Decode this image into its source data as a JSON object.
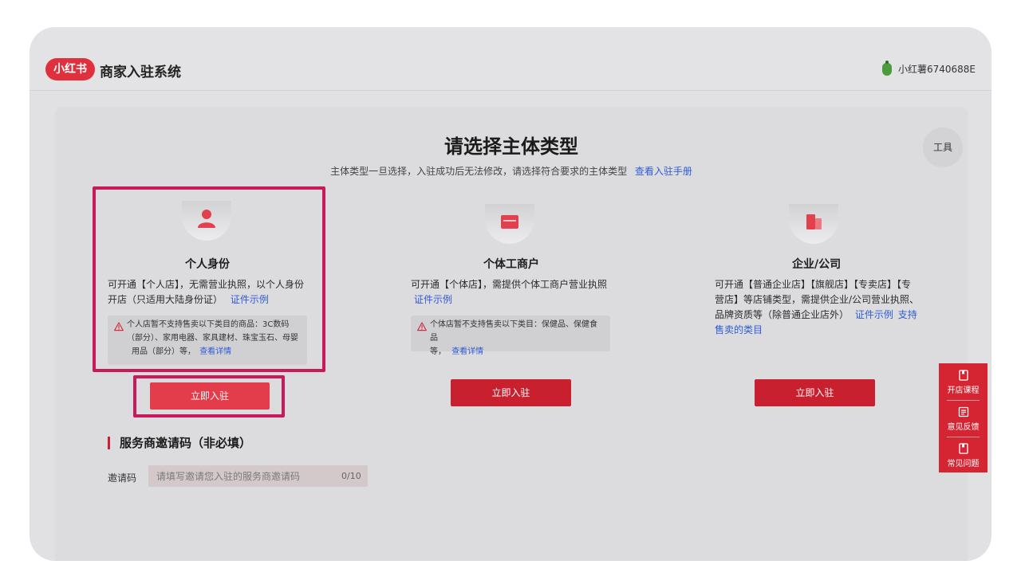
{
  "header": {
    "logo_text": "小红书",
    "app_title": "商家入驻系统",
    "username": "小红薯6740688E"
  },
  "page": {
    "title": "请选择主体类型",
    "subtitle": "主体类型一旦选择，入驻成功后无法修改，请选择符合要求的主体类型",
    "manual_link": "查看入驻手册",
    "tools_label": "工具"
  },
  "cards": [
    {
      "title": "个人身份",
      "desc_line1": "可开通【个人店】，无需营业执照，以个人身份",
      "desc_line2": "开店（只适用大陆身份证）",
      "example_link": "证件示例",
      "warn_line1": "个人店暂不支持售卖以下类目的商品：3C数码",
      "warn_line2": "（部分）、家用电器、家具建材、珠宝玉石、母婴",
      "warn_line3": "用品（部分）等，",
      "warn_link": "查看详情",
      "button": "立即入驻"
    },
    {
      "title": "个体工商户",
      "desc_line1": "可开通【个体店】，需提供个体工商户营业执照",
      "example_link": "证件示例",
      "warn_line1": "个体店暂不支持售卖以下类目：保健品、保健食品",
      "warn_line2": "等，",
      "warn_link": "查看详情",
      "button": "立即入驻"
    },
    {
      "title": "企业/公司",
      "desc_line1": "可开通【普通企业店】【旗舰店】【专卖店】【专",
      "desc_line2": "营店】等店铺类型，需提供企业/公司营业执照、",
      "desc_line3": "品牌资质等（除普通企业店外）",
      "example_link": "证件示例",
      "category_link_1": "支持",
      "category_link_2": "售卖的类目",
      "button": "立即入驻"
    }
  ],
  "invite": {
    "section_title": "服务商邀请码（非必填）",
    "label": "邀请码",
    "placeholder": "请填写邀请您入驻的服务商邀请码",
    "counter": "0/10"
  },
  "float_panel": [
    {
      "label": "开店课程",
      "icon": "book-icon"
    },
    {
      "label": "意见反馈",
      "icon": "feedback-icon"
    },
    {
      "label": "常见问题",
      "icon": "faq-icon"
    }
  ],
  "colors": {
    "brand": "#e0303e",
    "link": "#2f5bd8",
    "highlight": "#c8195a"
  }
}
